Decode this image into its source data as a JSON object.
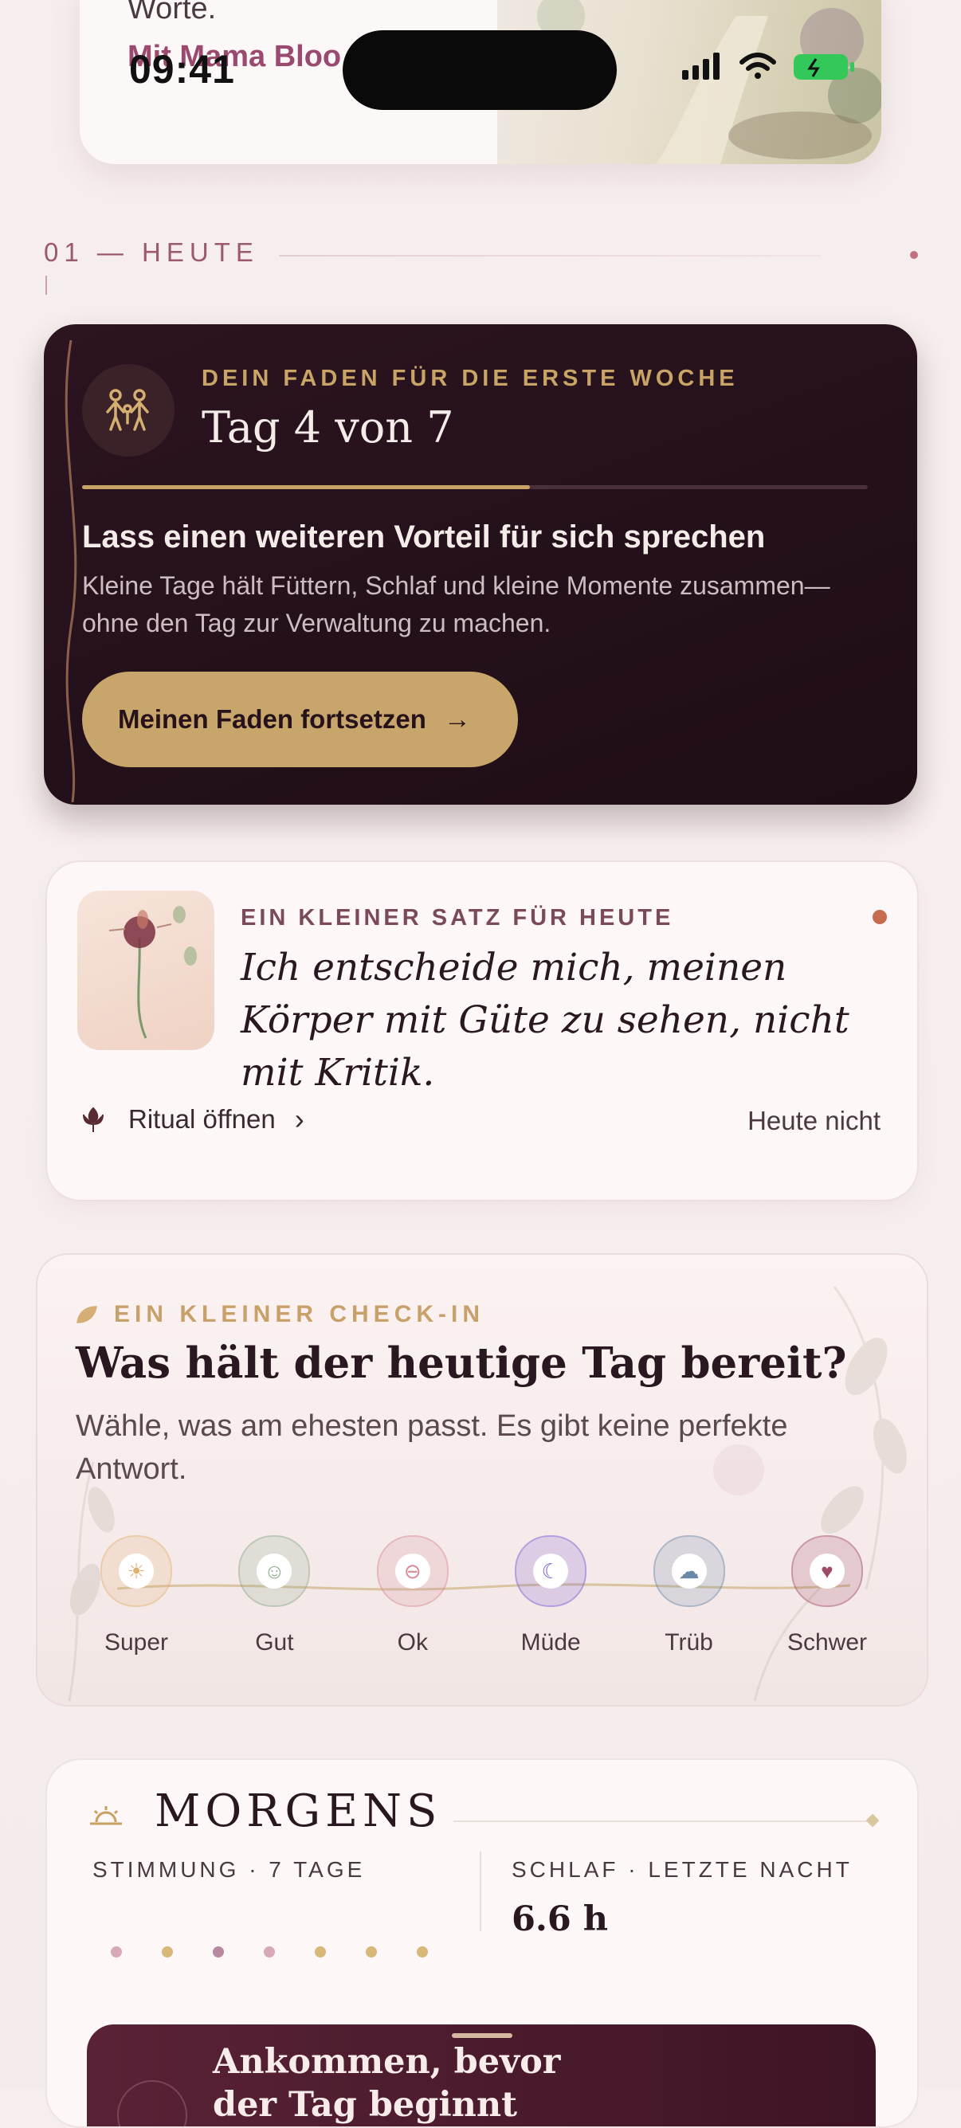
{
  "status_bar": {
    "time": "09:41"
  },
  "top_card": {
    "text": "Worte.",
    "link": "Mit Mama Bloo"
  },
  "section": {
    "label": "01 — HEUTE"
  },
  "thread_card": {
    "kicker": "DEIN FADEN FÜR DIE ERSTE WOCHE",
    "title": "Tag 4 von 7",
    "progress": 0.57,
    "heading": "Lass einen weiteren Vorteil für sich sprechen",
    "body": "Kleine Tage hält Füttern, Schlaf und kleine Momente zusammen—ohne den Tag zur Verwaltung zu machen.",
    "button": "Meinen Faden fortsetzen",
    "button_arrow": "→",
    "icon": "family-icon"
  },
  "sentence_card": {
    "kicker": "EIN KLEINER SATZ FÜR HEUTE",
    "quote": "Ich entscheide mich, meinen Körper mit Güte zu sehen, nicht mit Kritik.",
    "ritual": "Ritual öffnen",
    "ritual_chevron": "›",
    "skip": "Heute nicht",
    "accent": "#c86a50"
  },
  "checkin_card": {
    "kicker": "EIN KLEINER CHECK-IN",
    "title": "Was hält der heutige Tag bereit?",
    "subtitle": "Wähle, was am ehesten passt. Es gibt keine perfekte Antwort.",
    "moods": [
      {
        "label": "Super",
        "icon": "sun-icon",
        "glyph": "☀",
        "color": "#e0b070"
      },
      {
        "label": "Gut",
        "icon": "smile-icon",
        "glyph": "☺",
        "color": "#8aa88a"
      },
      {
        "label": "Ok",
        "icon": "neutral-icon",
        "glyph": "⊖",
        "color": "#d88a96"
      },
      {
        "label": "Müde",
        "icon": "moon-icon",
        "glyph": "☾",
        "color": "#7a5ad0"
      },
      {
        "label": "Trüb",
        "icon": "cloud-rain-icon",
        "glyph": "☁",
        "color": "#6a88a8"
      },
      {
        "label": "Schwer",
        "icon": "heart-icon",
        "glyph": "♥",
        "color": "#a04a6a"
      }
    ]
  },
  "morning_card": {
    "title": "MORGENS",
    "mood_label": "STIMMUNG · 7 TAGE",
    "sleep_label": "SCHLAF · LETZTE NACHT",
    "sleep_value": "6.6 h",
    "mood_dots": [
      "#d8a8b8",
      "#d8b878",
      "#b888a0",
      "#d8a8b8",
      "#d8b878",
      "#d8b878",
      "#d8b878"
    ],
    "arrive_title": "Ankommen, bevor der Tag beginnt"
  }
}
